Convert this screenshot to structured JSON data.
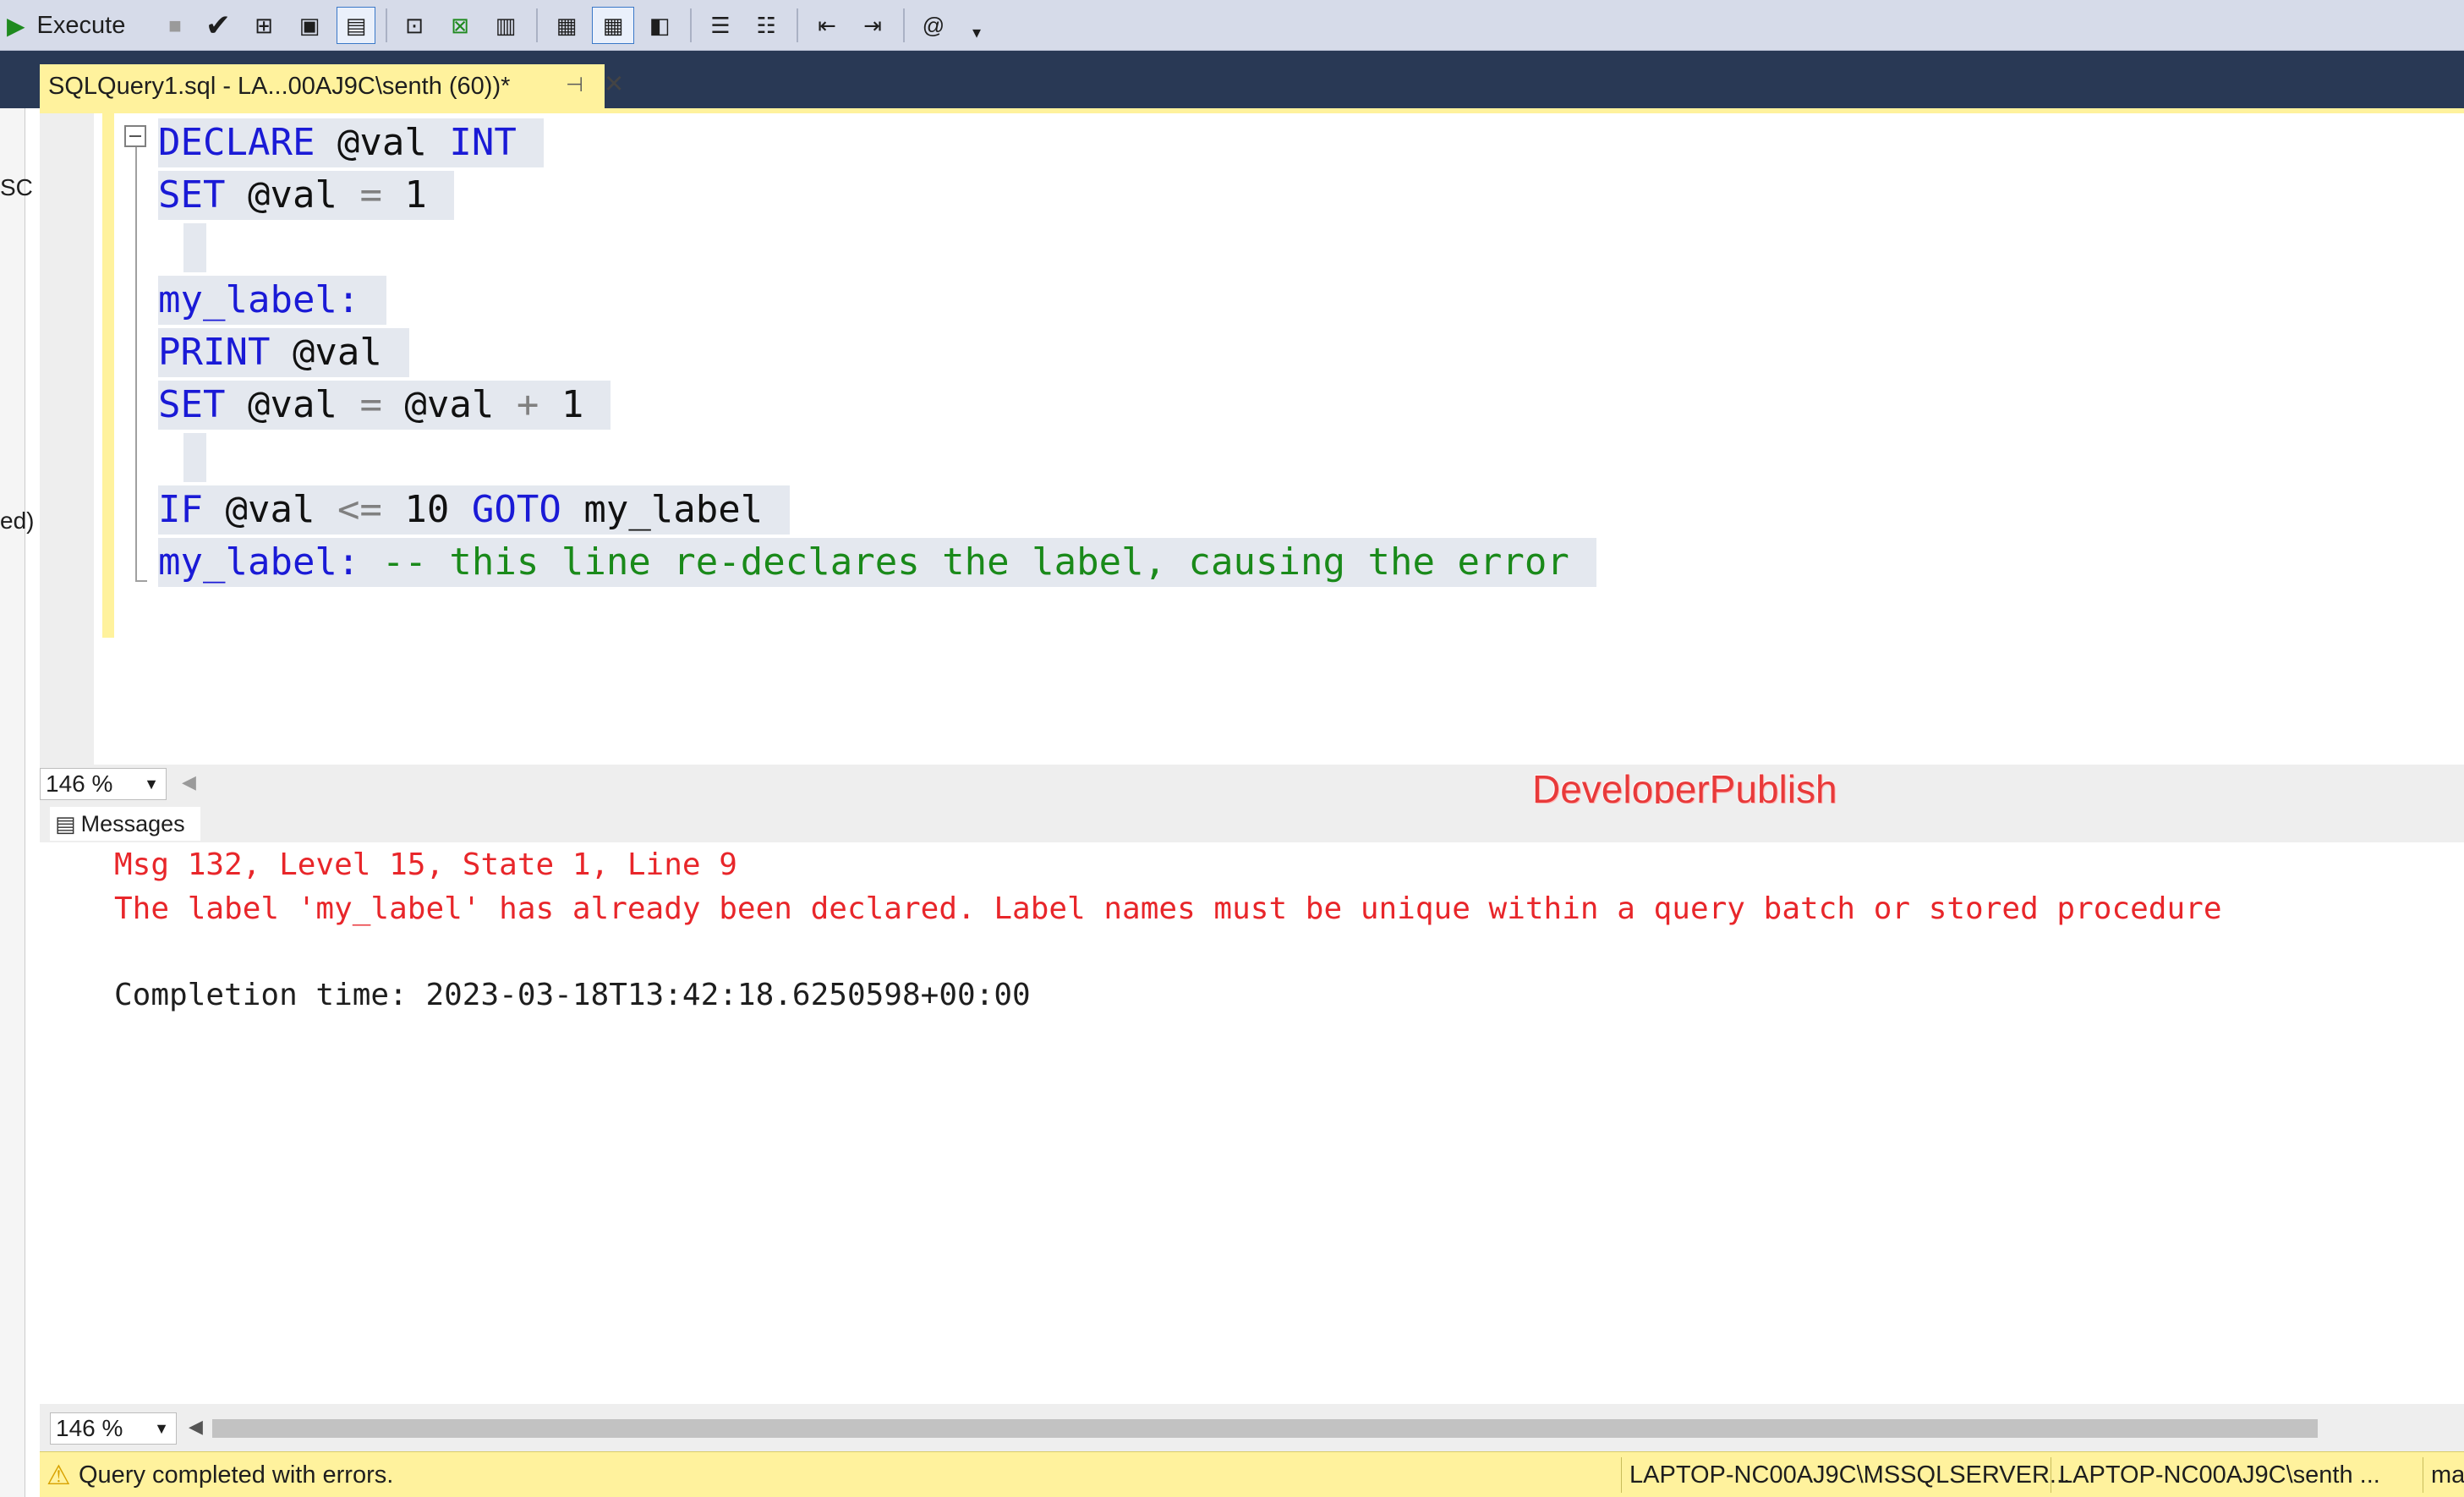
{
  "toolbar": {
    "execute_label": "Execute",
    "icons": [
      "execute-play-icon",
      "stop-icon",
      "parse-checkmark-icon",
      "display-estimated-plan-icon",
      "query-options-icon",
      "intellisense-icon",
      "include-actual-plan-icon",
      "include-live-stats-icon",
      "include-client-stats-icon",
      "results-to-text-icon",
      "results-to-grid-icon",
      "results-to-file-icon",
      "comment-lines-icon",
      "uncomment-lines-icon",
      "decrease-indent-icon",
      "increase-indent-icon",
      "specify-template-values-icon",
      "toolbar-overflow-icon"
    ]
  },
  "tab": {
    "title": "SQLQuery1.sql - LA...00AJ9C\\senth (60))*"
  },
  "left_panel": {
    "fragments": [
      "SC",
      "ed)"
    ]
  },
  "editor": {
    "lines": [
      [
        {
          "t": "DECLARE",
          "c": "kw"
        },
        {
          "t": " @val ",
          "c": "id"
        },
        {
          "t": "INT",
          "c": "kw"
        }
      ],
      [
        {
          "t": "SET",
          "c": "kw"
        },
        {
          "t": " @val ",
          "c": "id"
        },
        {
          "t": "=",
          "c": "op"
        },
        {
          "t": " 1",
          "c": "id"
        }
      ],
      [
        {
          "t": " ",
          "c": "id"
        }
      ],
      [
        {
          "t": "my_label:",
          "c": "lbl"
        }
      ],
      [
        {
          "t": "PRINT",
          "c": "kw"
        },
        {
          "t": " @val",
          "c": "id"
        }
      ],
      [
        {
          "t": "SET",
          "c": "kw"
        },
        {
          "t": " @val ",
          "c": "id"
        },
        {
          "t": "=",
          "c": "op"
        },
        {
          "t": " @val ",
          "c": "id"
        },
        {
          "t": "+",
          "c": "op"
        },
        {
          "t": " 1",
          "c": "id"
        }
      ],
      [
        {
          "t": " ",
          "c": "id"
        }
      ],
      [
        {
          "t": "IF",
          "c": "kw"
        },
        {
          "t": " @val ",
          "c": "id"
        },
        {
          "t": "<=",
          "c": "op"
        },
        {
          "t": " 10 ",
          "c": "id"
        },
        {
          "t": "GOTO",
          "c": "kw"
        },
        {
          "t": " my_label",
          "c": "id"
        }
      ],
      [
        {
          "t": "my_label:",
          "c": "lbl"
        },
        {
          "t": " -- this line re-declares the label, causing the error",
          "c": "cm"
        }
      ]
    ]
  },
  "editor_zoom": "146 %",
  "watermark": "DeveloperPublish",
  "results": {
    "tab_label": "Messages",
    "error_line1": "Msg 132, Level 15, State 1, Line 9",
    "error_line2": "The label 'my_label' has already been declared. Label names must be unique within a query batch or stored procedure",
    "completion": "Completion time: 2023-03-18T13:42:18.6250598+00:00"
  },
  "results_zoom": "146 %",
  "status": {
    "message": "Query completed with errors.",
    "server": "LAPTOP-NC00AJ9C\\MSSQLSERVER...",
    "user": "LAPTOP-NC00AJ9C\\senth ...",
    "database": "maste"
  },
  "colors": {
    "toolbar_bg": "#d6dbe9",
    "tabband_bg": "#293955",
    "tab_active_bg": "#fff29d",
    "keyword": "#1a1ad6",
    "comment": "#1a8a1a",
    "error_text": "#e8262a"
  }
}
